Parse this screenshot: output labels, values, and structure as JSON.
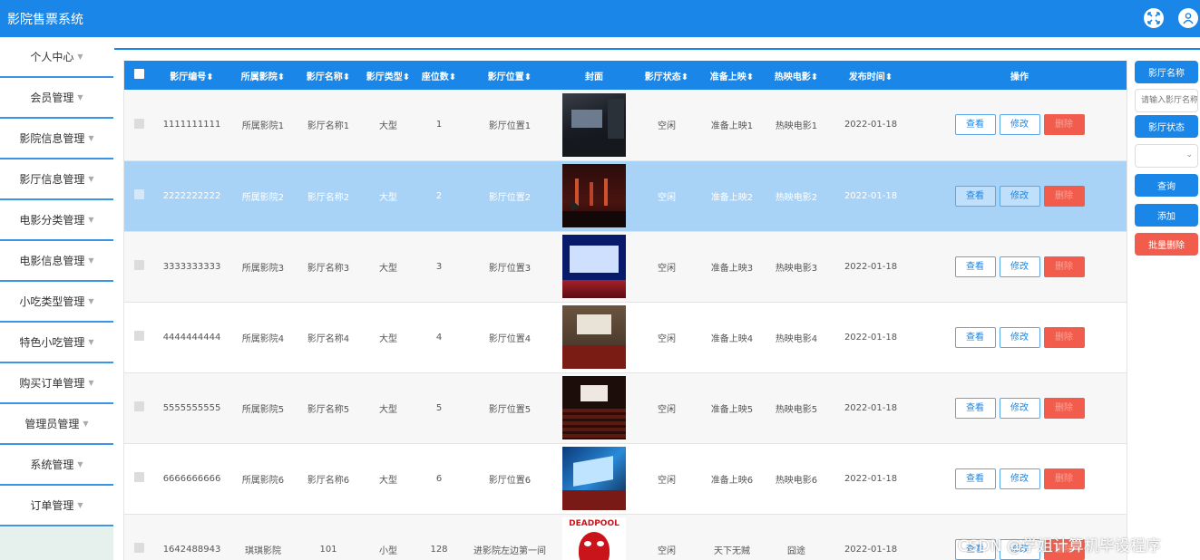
{
  "app": {
    "title": "影院售票系统"
  },
  "sidebar": {
    "items": [
      {
        "label": "个人中心"
      },
      {
        "label": "会员管理"
      },
      {
        "label": "影院信息管理"
      },
      {
        "label": "影厅信息管理"
      },
      {
        "label": "电影分类管理"
      },
      {
        "label": "电影信息管理"
      },
      {
        "label": "小吃类型管理"
      },
      {
        "label": "特色小吃管理"
      },
      {
        "label": "购买订单管理"
      },
      {
        "label": "管理员管理"
      },
      {
        "label": "系统管理"
      },
      {
        "label": "订单管理"
      }
    ]
  },
  "table": {
    "headers": [
      "影厅编号",
      "所属影院",
      "影厅名称",
      "影厅类型",
      "座位数",
      "影厅位置",
      "封面",
      "影厅状态",
      "准备上映",
      "热映电影",
      "发布时间",
      "操作"
    ],
    "sort_marker": "⬍",
    "rows": [
      {
        "id": "1111111111",
        "cinema": "所属影院1",
        "name": "影厅名称1",
        "type": "大型",
        "seats": "1",
        "location": "影厅位置1",
        "status": "空闲",
        "upcoming": "准备上映1",
        "hot": "热映电影1",
        "date": "2022-01-18"
      },
      {
        "id": "2222222222",
        "cinema": "所属影院2",
        "name": "影厅名称2",
        "type": "大型",
        "seats": "2",
        "location": "影厅位置2",
        "status": "空闲",
        "upcoming": "准备上映2",
        "hot": "热映电影2",
        "date": "2022-01-18"
      },
      {
        "id": "3333333333",
        "cinema": "所属影院3",
        "name": "影厅名称3",
        "type": "大型",
        "seats": "3",
        "location": "影厅位置3",
        "status": "空闲",
        "upcoming": "准备上映3",
        "hot": "热映电影3",
        "date": "2022-01-18"
      },
      {
        "id": "4444444444",
        "cinema": "所属影院4",
        "name": "影厅名称4",
        "type": "大型",
        "seats": "4",
        "location": "影厅位置4",
        "status": "空闲",
        "upcoming": "准备上映4",
        "hot": "热映电影4",
        "date": "2022-01-18"
      },
      {
        "id": "5555555555",
        "cinema": "所属影院5",
        "name": "影厅名称5",
        "type": "大型",
        "seats": "5",
        "location": "影厅位置5",
        "status": "空闲",
        "upcoming": "准备上映5",
        "hot": "热映电影5",
        "date": "2022-01-18"
      },
      {
        "id": "6666666666",
        "cinema": "所属影院6",
        "name": "影厅名称6",
        "type": "大型",
        "seats": "6",
        "location": "影厅位置6",
        "status": "空闲",
        "upcoming": "准备上映6",
        "hot": "热映电影6",
        "date": "2022-01-18"
      },
      {
        "id": "1642488943",
        "cinema": "琪琪影院",
        "name": "101",
        "type": "小型",
        "seats": "128",
        "location": "进影院左边第一间",
        "status": "空闲",
        "upcoming": "天下无贼",
        "hot": "囧途",
        "date": "2022-01-18"
      }
    ],
    "actions": {
      "view": "查看",
      "edit": "修改",
      "delete": "删除"
    },
    "last_cover_text": "DEADPOOL"
  },
  "search_panel": {
    "name_button": "影厅名称",
    "name_placeholder": "请输入影厅名称",
    "status_button": "影厅状态",
    "query_button": "查询",
    "add_button": "添加",
    "batch_delete_button": "批量删除"
  },
  "watermark": "CSDN @学姐计算机毕设程序",
  "colors": {
    "primary": "#1a86e8",
    "danger": "#f25c4c",
    "selected_row": "#a9d3f6"
  }
}
